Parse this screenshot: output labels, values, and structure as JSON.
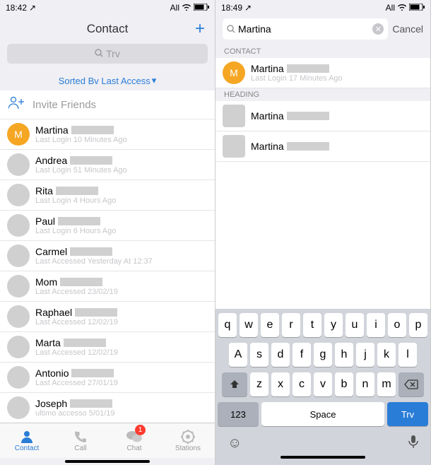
{
  "left": {
    "status": {
      "time": "18:42",
      "right": "All"
    },
    "header": {
      "title": "Contact",
      "search_placeholder": "Trv",
      "sort": "Sorted Bv Last Access"
    },
    "invite": "Invite Friends",
    "contacts": [
      {
        "name": "Martina",
        "sub": "Last Login 10 Minutes Ago",
        "avatar": "M",
        "orange": true
      },
      {
        "name": "Andrea",
        "sub": "Last Login 51 Minutes Ago"
      },
      {
        "name": "Rita",
        "sub": "Last Login 4 Hours Ago"
      },
      {
        "name": "Paul",
        "sub": "Last Login 6 Hours Ago"
      },
      {
        "name": "Carmel",
        "sub": "Last Accessed Yesterday At 12:37"
      },
      {
        "name": "Mom",
        "sub": "Last Accessed 23/02/19"
      },
      {
        "name": "Raphael",
        "sub": "Last Accessed 12/02/19"
      },
      {
        "name": "Marta",
        "sub": "Last Accessed 12/02/19"
      },
      {
        "name": "Antonio",
        "sub": "Last Accessed 27/01/19"
      },
      {
        "name": "Joseph",
        "sub": "ultimo accesso 5/01/19"
      }
    ],
    "tabs": [
      {
        "label": "Contact",
        "active": true
      },
      {
        "label": "Call"
      },
      {
        "label": "Chat",
        "badge": "1"
      },
      {
        "label": "Stations"
      }
    ]
  },
  "right": {
    "status": {
      "time": "18:49",
      "right": "All"
    },
    "search": {
      "value": "Martina",
      "cancel": "Cancel"
    },
    "sections": {
      "contact_header": "CONTACT",
      "heading_header": "HEADING",
      "contacts": [
        {
          "name": "Martina",
          "sub": "Last Login 17 Minutes Ago",
          "avatar": "M",
          "orange": true
        }
      ],
      "headings": [
        {
          "name": "Martina"
        },
        {
          "name": "Martina"
        }
      ]
    },
    "keyboard": {
      "row1": [
        "q",
        "w",
        "e",
        "r",
        "t",
        "y",
        "u",
        "i",
        "o",
        "p"
      ],
      "row2": [
        "A",
        "s",
        "d",
        "f",
        "g",
        "h",
        "j",
        "k",
        "l"
      ],
      "row3": [
        "z",
        "x",
        "c",
        "v",
        "b",
        "n",
        "m"
      ],
      "num": "123",
      "space": "Space",
      "action": "Trv"
    }
  }
}
